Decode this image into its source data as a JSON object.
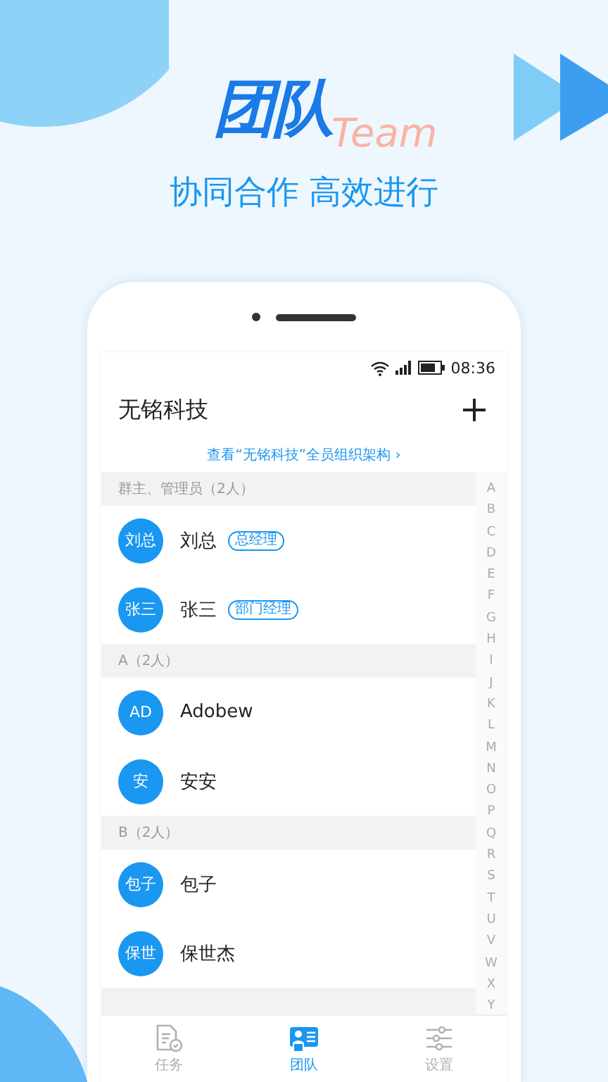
{
  "promo": {
    "logo": "团队",
    "logo_subtitle": "Team",
    "slogan": "协同合作 高效进行"
  },
  "phone": {
    "status_bar": {
      "time": "08:36"
    },
    "app_title": "无铭科技",
    "org_link": "查看“无铭科技”全员组织架构",
    "org_link_chevron": "›",
    "groups": [
      {
        "title": "群主、管理员（2人）",
        "members": [
          {
            "avatar": "刘总",
            "name": "刘总",
            "role": "总经理"
          },
          {
            "avatar": "张三",
            "name": "张三",
            "role": "部门经理"
          }
        ]
      },
      {
        "title": "A（2人）",
        "members": [
          {
            "avatar": "AD",
            "name": "Adobew"
          },
          {
            "avatar": "安",
            "name": "安安"
          }
        ]
      },
      {
        "title": "B（2人）",
        "members": [
          {
            "avatar": "包子",
            "name": "包子"
          },
          {
            "avatar": "保世",
            "name": "保世杰"
          }
        ]
      }
    ],
    "index_letters": [
      "A",
      "B",
      "C",
      "D",
      "E",
      "F",
      "G",
      "H",
      "I",
      "J",
      "K",
      "L",
      "M",
      "N",
      "O",
      "P",
      "Q",
      "R",
      "S",
      "T",
      "U",
      "V",
      "W",
      "X",
      "Y"
    ],
    "tabs": [
      {
        "kind": "tasks",
        "label": "任务",
        "selected": false
      },
      {
        "kind": "team",
        "label": "团队",
        "selected": true
      },
      {
        "kind": "settings",
        "label": "设置",
        "selected": false
      }
    ]
  }
}
